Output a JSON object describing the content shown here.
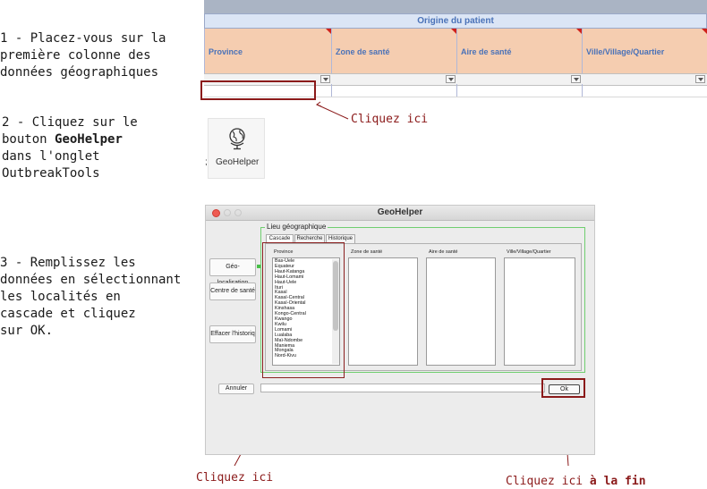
{
  "steps": [
    {
      "text": "1 - Placez-vous sur la\npremière colonne des\ndonnées géographiques"
    },
    {
      "prefix": "2 - Cliquez sur le\nbouton ",
      "bold": "GeoHelper",
      "suffix": "\ndans l'onglet\nOutbreakTools"
    },
    {
      "text": "3 - Remplissez les\ndonnées en sélectionnant\nles localités en\ncascade et cliquez\nsur OK."
    }
  ],
  "sheet": {
    "group_header": "Origine du patient",
    "columns": [
      "Province",
      "Zone de santé",
      "Aire de santé",
      "Ville/Village/Quartier"
    ]
  },
  "callouts": {
    "cell": "Cliquez ici",
    "list": "Cliquez ici",
    "ok_prefix": "Cliquez ici ",
    "ok_bold": "à la fin"
  },
  "ribbon": {
    "label_prefix": ";",
    "label": "GeoHelper",
    "icon": "globe-icon"
  },
  "dialog": {
    "title": "GeoHelper",
    "frame_title": "Lieu géographique",
    "tabs": [
      "Cascade",
      "Recherche",
      "Historique"
    ],
    "side_buttons": [
      "Géo-localisation",
      "Centre de santé",
      "Effacer l'historiq"
    ],
    "cancel": "Annuler",
    "ok": "Ok",
    "list_headers": [
      "Province",
      "Zone de santé",
      "Aire de santé",
      "Ville/Village/Quartier"
    ],
    "provinces": [
      "Bas-Uele",
      "Equateur",
      "Haut-Katanga",
      "Haut-Lomami",
      "Haut-Uele",
      "Ituri",
      "Kasaï",
      "Kasaï-Central",
      "Kasaï-Oriental",
      "Kinshasa",
      "Kongo-Central",
      "Kwango",
      "Kwilu",
      "Lomami",
      "Lualaba",
      "Maï-Ndombe",
      "Maniema",
      "Mongala",
      "Nord-Kivu"
    ]
  },
  "colors": {
    "accent_red": "#8b1a1a",
    "sheet_header": "#f5cdb0",
    "group_header_text": "#4a72b8",
    "frame_green": "#6fce6f"
  }
}
